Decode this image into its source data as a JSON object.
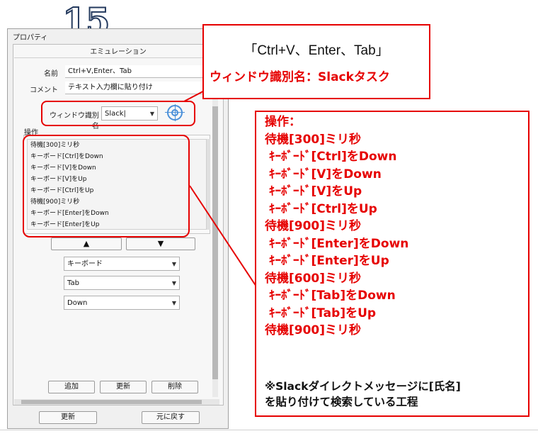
{
  "step_number": "15",
  "window": {
    "title": "プロパティ",
    "controls": "▾ ✕",
    "section_title": "エミュレーション",
    "name_label": "名前",
    "name_value": "Ctrl+V,Enter、Tab",
    "comment_label": "コメント",
    "comment_value": "テキスト入力欄に貼り付け",
    "window_id_label": "ウィンドウ識別名",
    "window_id_value": "Slack|",
    "operations_label": "操作",
    "operations": [
      "待機[300]ミリ秒",
      "キーボード[Ctrl]をDown",
      "キーボード[V]をDown",
      "キーボード[V]をUp",
      "キーボード[Ctrl]をUp",
      "待機[900]ミリ秒",
      "キーボード[Enter]をDown",
      "キーボード[Enter]をUp"
    ],
    "move_up": "▲",
    "move_down": "▼",
    "dropdown_device": "キーボード",
    "dropdown_key": "Tab",
    "dropdown_action": "Down",
    "btn_add": "追加",
    "btn_update": "更新",
    "btn_delete": "削除",
    "btn_apply": "更新",
    "btn_revert": "元に戻す"
  },
  "callout_top": {
    "title": "「Ctrl+V、Enter、Tab」",
    "subtitle": "ウィンドウ識別名：Slackタスク"
  },
  "callout_ops": {
    "lines": [
      "操作：",
      "待機[300]ミリ秒",
      "ｷｰﾎﾞｰﾄﾞ[Ctrl]をDown",
      "ｷｰﾎﾞｰﾄﾞ[V]をDown",
      "ｷｰﾎﾞｰﾄﾞ[V]をUp",
      "ｷｰﾎﾞｰﾄﾞ[Ctrl]をUp",
      "待機[900]ミリ秒",
      "ｷｰﾎﾞｰﾄﾞ[Enter]をDown",
      "ｷｰﾎﾞｰﾄﾞ[Enter]をUp",
      "待機[600]ミリ秒",
      "ｷｰﾎﾞｰﾄﾞ[Tab]をDown",
      "ｷｰﾎﾞｰﾄﾞ[Tab]をUp",
      "待機[900]ミリ秒"
    ],
    "note_line1": "※Slackダイレクトメッセージに[氏名]",
    "note_line2": "を貼り付けて検索している工程"
  },
  "colors": {
    "accent_red": "#e60000",
    "target_blue": "#4a90d9"
  },
  "icons": {
    "target": "crosshair-target-icon"
  }
}
